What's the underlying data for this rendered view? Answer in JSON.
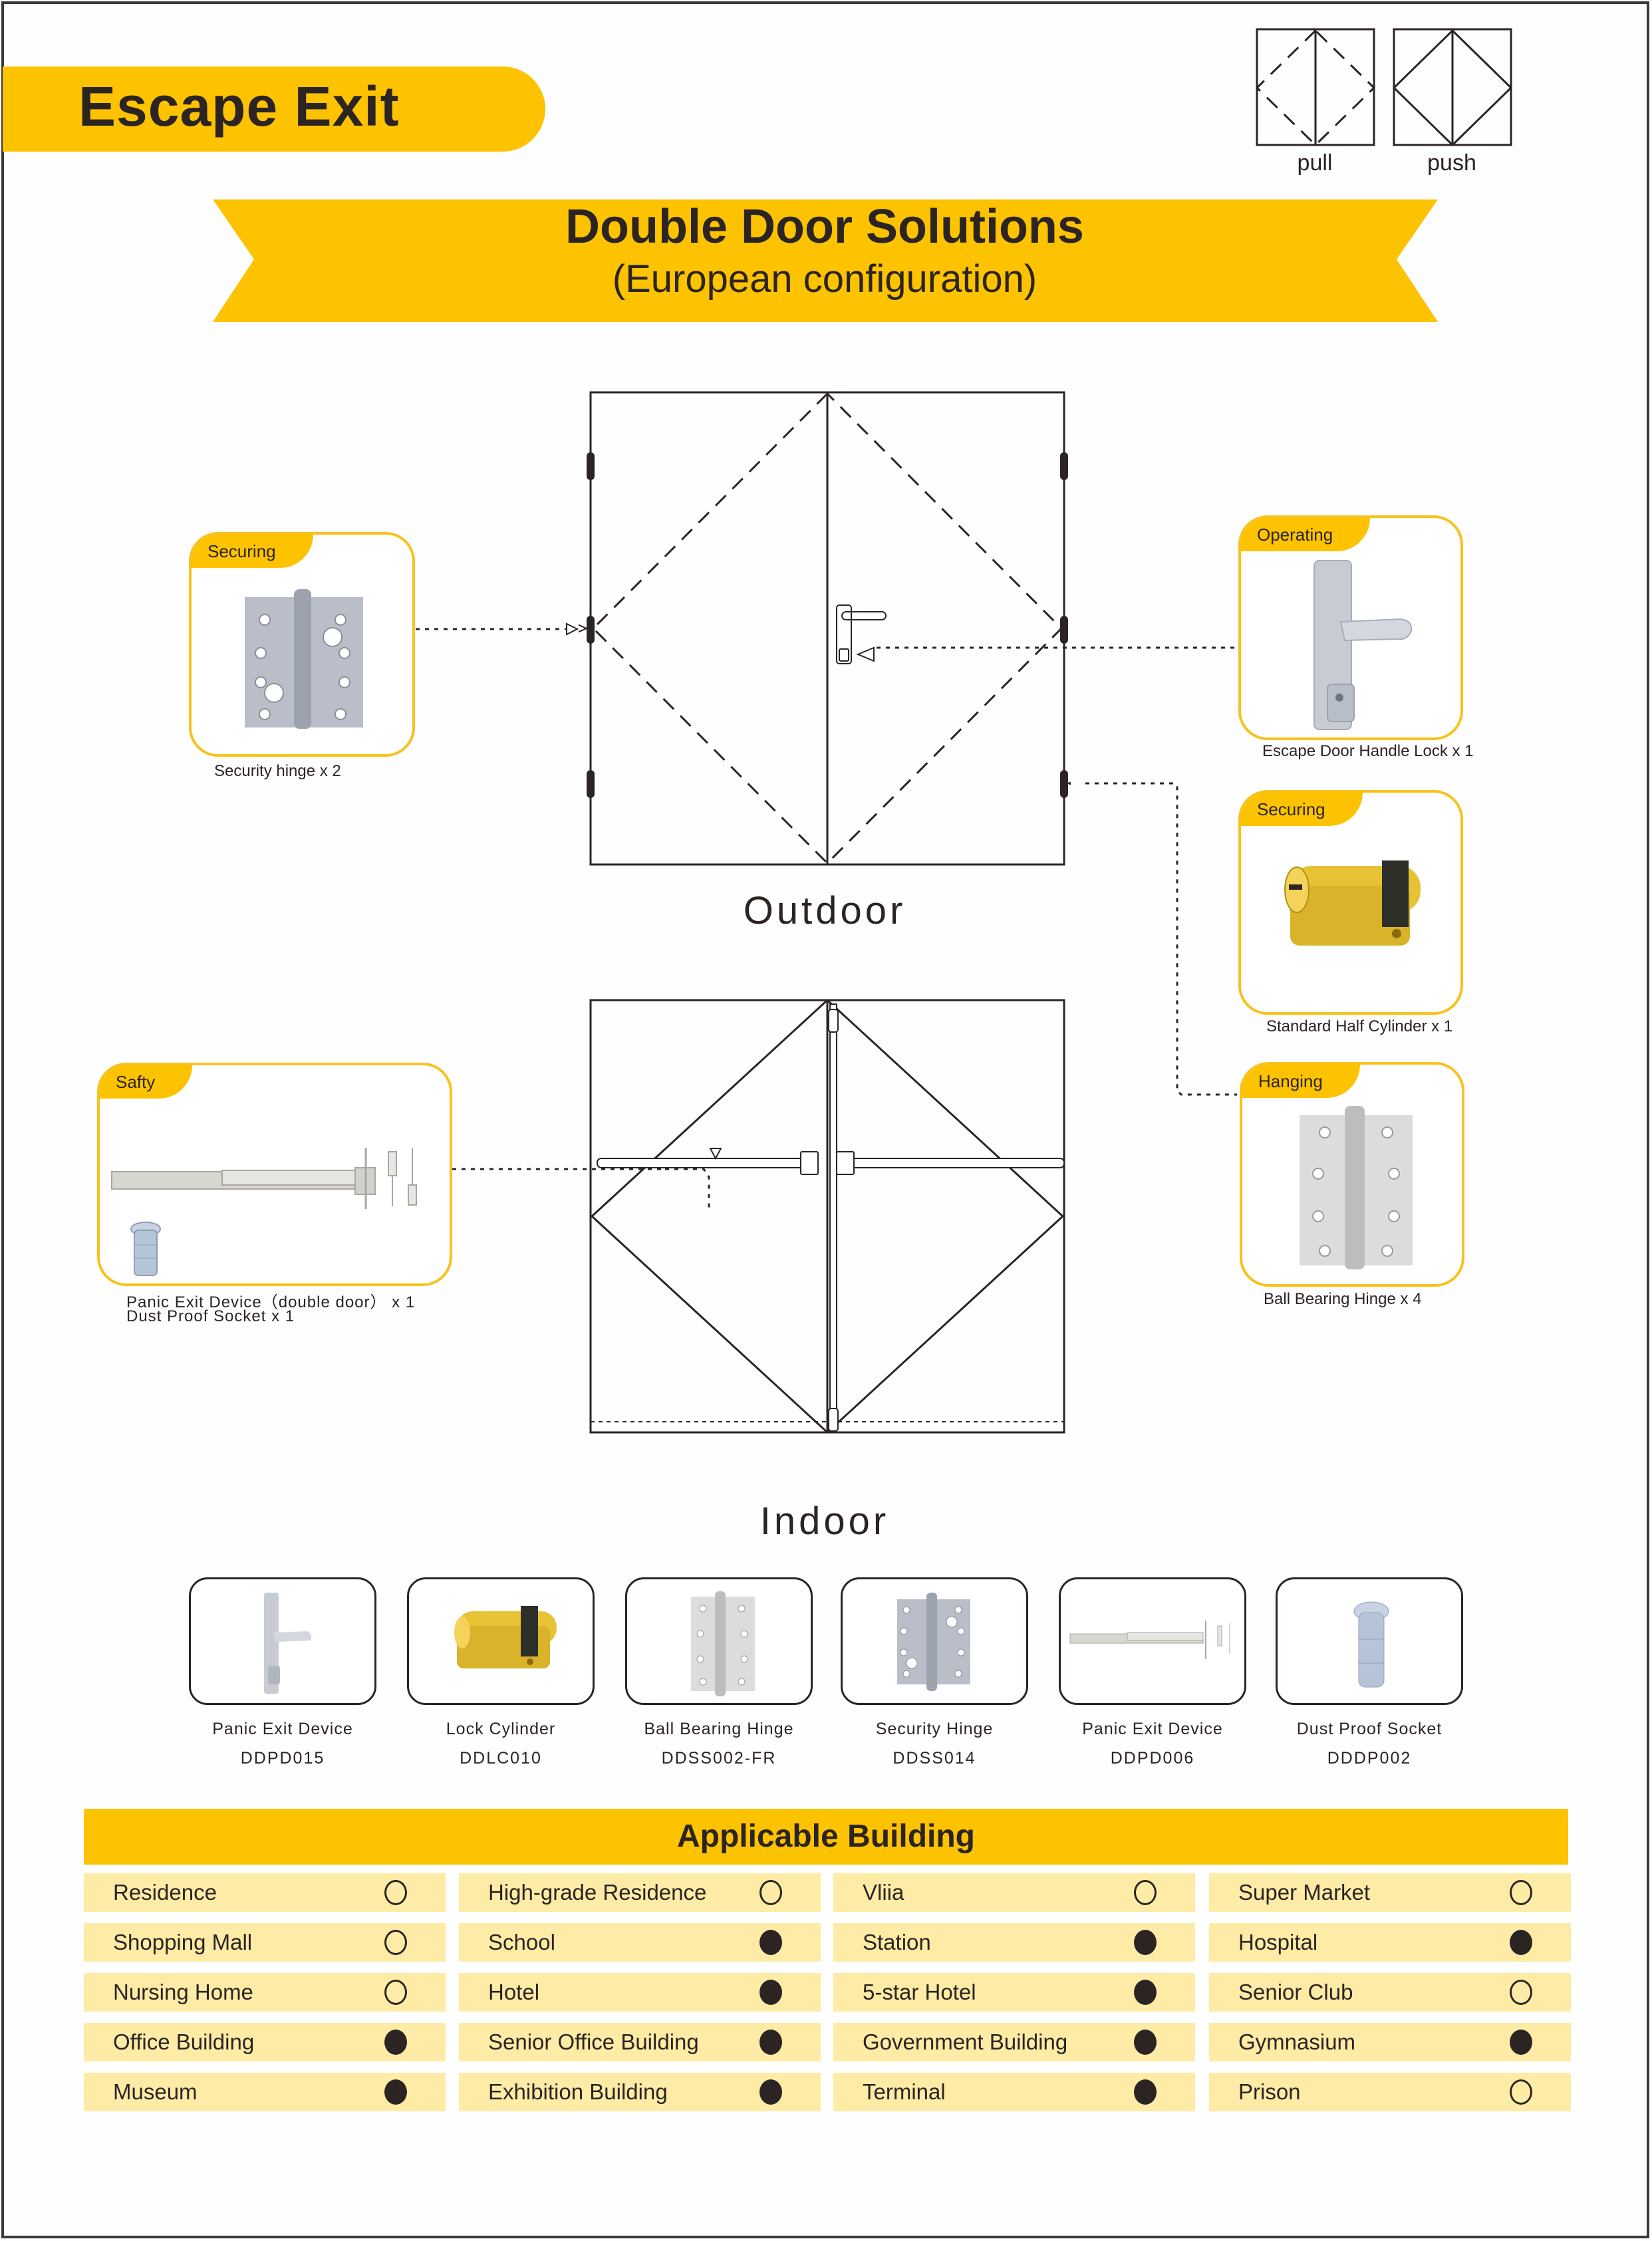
{
  "header": {
    "title": "Escape Exit",
    "banner_title": "Double Door Solutions",
    "banner_subtitle": "(European configuration)"
  },
  "legend": [
    {
      "label": "pull",
      "icon": "door-pull-icon"
    },
    {
      "label": "push",
      "icon": "door-push-icon"
    }
  ],
  "diagrams": {
    "outdoor_label": "Outdoor",
    "indoor_label": "Indoor"
  },
  "callouts": {
    "security_hinge": {
      "tag": "Securing",
      "caption": "Security hinge x 2"
    },
    "handle_lock": {
      "tag": "Operating",
      "caption": "Escape Door Handle Lock x 1"
    },
    "half_cylinder": {
      "tag": "Securing",
      "caption": "Standard Half Cylinder x 1"
    },
    "ball_hinge": {
      "tag": "Hanging",
      "caption": "Ball Bearing Hinge x 4"
    },
    "panic_device": {
      "tag": "Safty",
      "caption_line1": "Panic  Exit  Device（double  door） x 1",
      "caption_line2": "Dust  Proof Socket  x 1"
    }
  },
  "products": [
    {
      "name": "Panic Exit Device",
      "code": "DDPD015",
      "icon": "handle-lock-icon"
    },
    {
      "name": "Lock Cylinder",
      "code": "DDLC010",
      "icon": "cylinder-icon"
    },
    {
      "name": "Ball Bearing Hinge",
      "code": "DDSS002-FR",
      "icon": "ball-hinge-icon"
    },
    {
      "name": "Security Hinge",
      "code": "DDSS014",
      "icon": "security-hinge-icon"
    },
    {
      "name": "Panic Exit Device",
      "code": "DDPD006",
      "icon": "panic-bar-icon"
    },
    {
      "name": "Dust Proof Socket",
      "code": "DDDP002",
      "icon": "dust-socket-icon"
    }
  ],
  "applicable": {
    "title": "Applicable Building",
    "rows": [
      [
        {
          "label": "Residence",
          "on": false
        },
        {
          "label": "High-grade Residence",
          "on": false
        },
        {
          "label": "Vliia",
          "on": false
        },
        {
          "label": "Super Market",
          "on": false
        }
      ],
      [
        {
          "label": "Shopping Mall",
          "on": false
        },
        {
          "label": "School",
          "on": true
        },
        {
          "label": "Station",
          "on": true
        },
        {
          "label": "Hospital",
          "on": true
        }
      ],
      [
        {
          "label": "Nursing Home",
          "on": false
        },
        {
          "label": "Hotel",
          "on": true
        },
        {
          "label": "5-star Hotel",
          "on": true
        },
        {
          "label": "Senior Club",
          "on": false
        }
      ],
      [
        {
          "label": "Office Building",
          "on": true
        },
        {
          "label": "Senior Office Building",
          "on": true
        },
        {
          "label": "Government Building",
          "on": true
        },
        {
          "label": "Gymnasium",
          "on": true
        }
      ],
      [
        {
          "label": "Museum",
          "on": true
        },
        {
          "label": "Exhibition Building",
          "on": true
        },
        {
          "label": "Terminal",
          "on": true
        },
        {
          "label": "Prison",
          "on": false
        }
      ]
    ]
  },
  "colors": {
    "accent": "#fdc300",
    "cell_bg": "#feeca6",
    "ink": "#2b2422"
  }
}
